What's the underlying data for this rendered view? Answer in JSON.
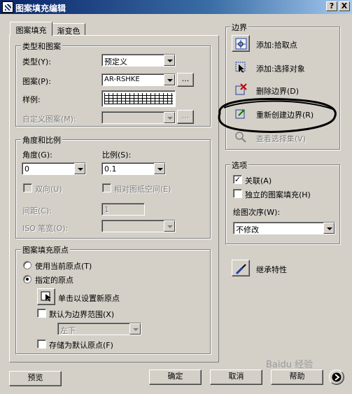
{
  "window": {
    "title": "图案填充编辑",
    "help_btn": "?",
    "close_btn": "X"
  },
  "tabs": [
    {
      "label": "图案填充",
      "active": true
    },
    {
      "label": "渐变色",
      "active": false
    }
  ],
  "type_pattern": {
    "title": "类型和图案",
    "type_label": "类型(Y):",
    "type_value": "预定义",
    "pattern_label": "图案(P):",
    "pattern_value": "AR-RSHKE",
    "browse_btn": "...",
    "swatch_label": "样例:",
    "custom_label": "自定义图案(M):",
    "custom_value": "",
    "custom_browse": "..."
  },
  "angle_scale": {
    "title": "角度和比例",
    "angle_label": "角度(G):",
    "angle_value": "0",
    "scale_label": "比例(S):",
    "scale_value": "0.1",
    "double_label": "双向(U)",
    "relative_label": "相对图纸空间(E)",
    "spacing_label": "间距(C):",
    "spacing_value": "1",
    "iso_label": "ISO 笔宽(O):",
    "iso_value": ""
  },
  "origin": {
    "title": "图案填充原点",
    "use_current": "使用当前原点(T)",
    "specified": "指定的原点",
    "click_set": "单击以设置新原点",
    "default_extent": "默认为边界范围(X)",
    "position_value": "左下",
    "store_default": "存储为默认原点(F)"
  },
  "boundary": {
    "title": "边界",
    "add_pick": "添加:拾取点",
    "add_select": "添加:选择对象",
    "remove": "删除边界(D)",
    "recreate": "重新创建边界(R)",
    "view_selection": "查看选择集(V)"
  },
  "options": {
    "title": "选项",
    "associative": "关联(A)",
    "separate": "独立的图案填充(H)",
    "draw_order_label": "绘图次序(W):",
    "draw_order_value": "不修改"
  },
  "inherit": "继承特性",
  "footer": {
    "preview": "预览",
    "ok": "确定",
    "cancel": "取消",
    "help": "帮助",
    "more_icon": "chevron-right-icon"
  },
  "watermark": "Baidu 经验"
}
